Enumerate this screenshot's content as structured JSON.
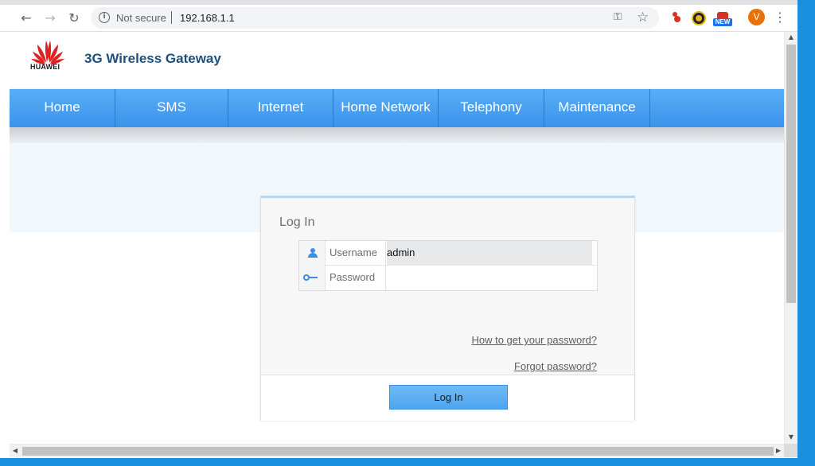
{
  "browser": {
    "security_text": "Not secure",
    "url": "192.168.1.1",
    "profile_initial": "V",
    "extension_badge": "NEW",
    "icons": [
      "back-icon",
      "forward-icon",
      "reload-icon",
      "info-icon",
      "key-icon",
      "star-icon",
      "menu-icon"
    ]
  },
  "header": {
    "logo_text": "HUAWEI",
    "title": "3G Wireless Gateway"
  },
  "nav": {
    "items": [
      "Home",
      "SMS",
      "Internet",
      "Home Network",
      "Telephony",
      "Maintenance"
    ]
  },
  "login": {
    "title": "Log In",
    "username_label": "Username",
    "username_value": "admin",
    "password_label": "Password",
    "password_value": "",
    "help_link": "How to get your password?",
    "forgot_link": "Forgot password?",
    "submit_label": "Log In"
  },
  "colors": {
    "nav_blue": "#3b92ea",
    "brand_title": "#1f4f7c",
    "logo_red": "#e02020",
    "profile_orange": "#e8710a"
  }
}
